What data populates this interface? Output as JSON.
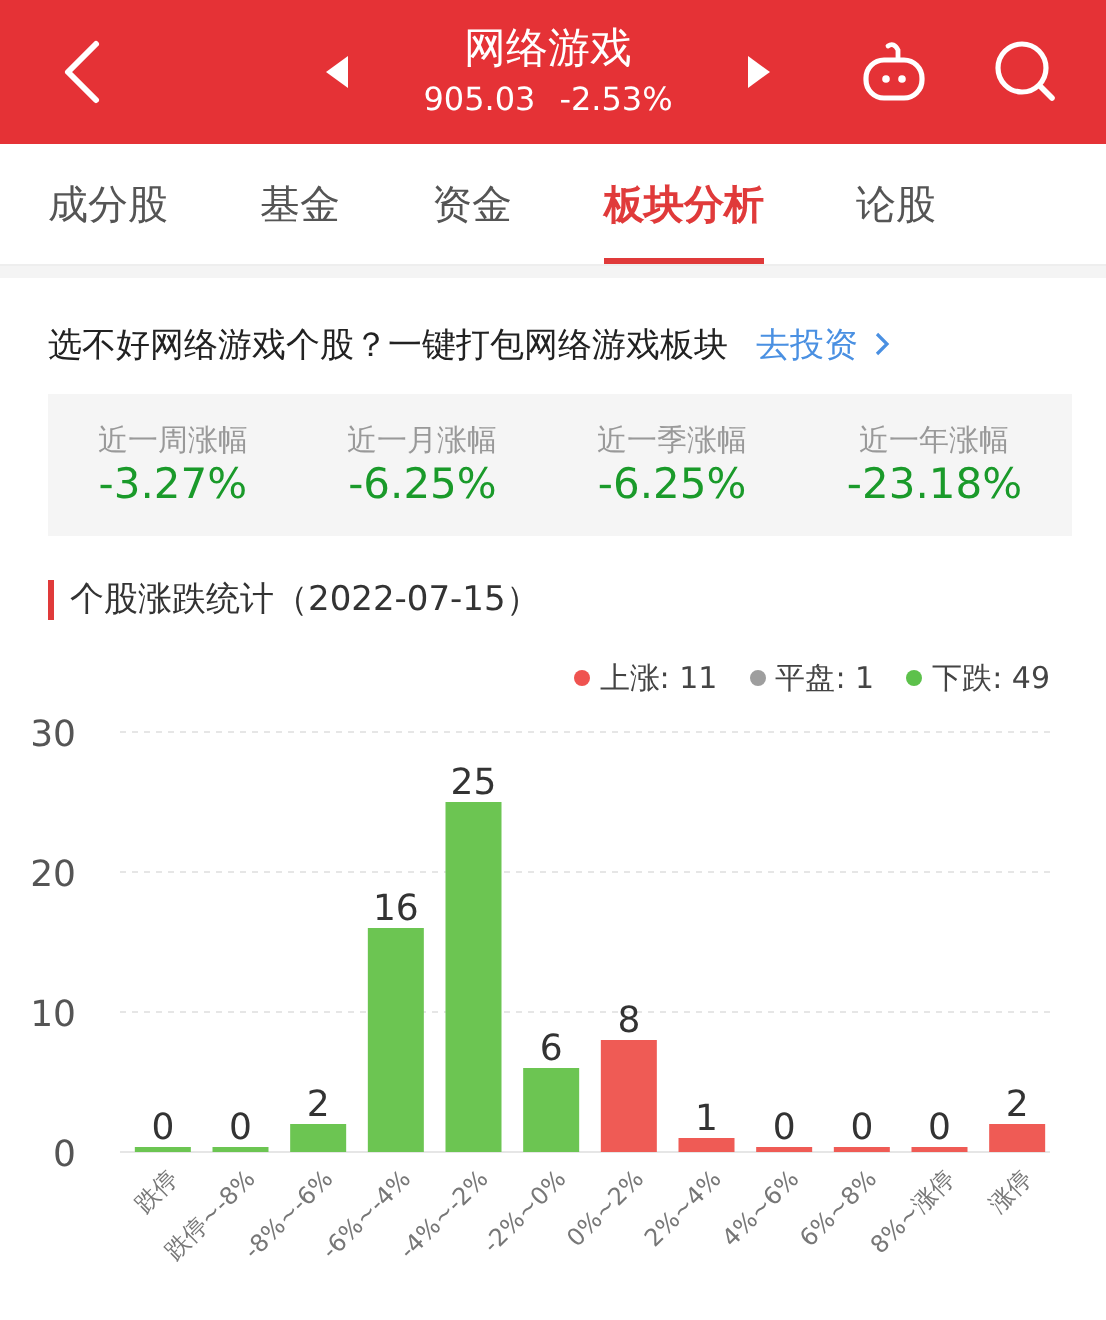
{
  "header": {
    "title": "网络游戏",
    "price": "905.03",
    "change": "-2.53%"
  },
  "tabs": [
    {
      "label": "成分股",
      "selected": false
    },
    {
      "label": "基金",
      "selected": false
    },
    {
      "label": "资金",
      "selected": false
    },
    {
      "label": "板块分析",
      "selected": true
    },
    {
      "label": "论股",
      "selected": false
    }
  ],
  "promo": {
    "text": "选不好网络游戏个股？一键打包网络游戏板块",
    "link": "去投资"
  },
  "stats": [
    {
      "label": "近一周涨幅",
      "value": "-3.27%"
    },
    {
      "label": "近一月涨幅",
      "value": "-6.25%"
    },
    {
      "label": "近一季涨幅",
      "value": "-6.25%"
    },
    {
      "label": "近一年涨幅",
      "value": "-23.18%"
    }
  ],
  "section_title": "个股涨跌统计（2022-07-15）",
  "legend": [
    {
      "label": "上涨: 11",
      "color": "#ef5350"
    },
    {
      "label": "平盘: 1",
      "color": "#9e9e9e"
    },
    {
      "label": "下跌: 49",
      "color": "#5dc14b"
    }
  ],
  "chart_data": {
    "type": "bar",
    "data_labels": true,
    "yticks": [
      0,
      10,
      20,
      30
    ],
    "ylim": [
      0,
      30
    ],
    "categories": [
      "跌停",
      "跌停~-8%",
      "-8%~-6%",
      "-6%~-4%",
      "-4%~-2%",
      "-2%~0%",
      "0%~2%",
      "2%~4%",
      "4%~6%",
      "6%~8%",
      "8%~涨停",
      "涨停"
    ],
    "series": [
      {
        "color": "#6cc552",
        "values": [
          0,
          0,
          2,
          16,
          25,
          6,
          null,
          null,
          null,
          null,
          null,
          null
        ]
      },
      {
        "color": "#ef5b55",
        "values": [
          null,
          null,
          null,
          null,
          null,
          null,
          8,
          1,
          0,
          0,
          0,
          2
        ]
      }
    ]
  }
}
